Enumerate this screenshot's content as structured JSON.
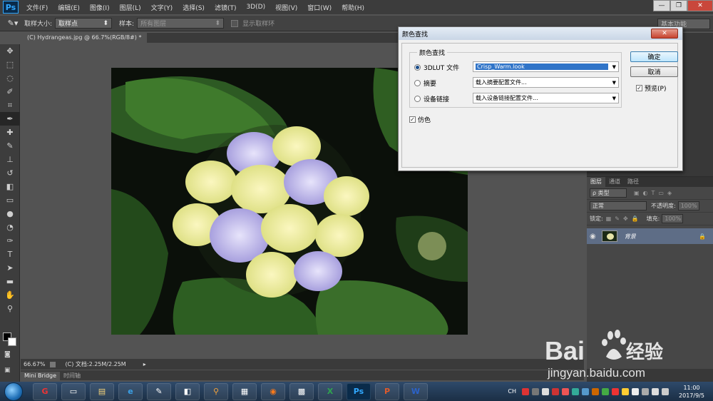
{
  "app": {
    "logo": "Ps",
    "menu": [
      "文件(F)",
      "编辑(E)",
      "图像(I)",
      "图层(L)",
      "文字(Y)",
      "选择(S)",
      "滤镜(T)",
      "3D(D)",
      "视图(V)",
      "窗口(W)",
      "帮助(H)"
    ],
    "window_controls": {
      "minimize": "—",
      "restore": "❐",
      "close": "✕"
    }
  },
  "options": {
    "sample_size_label": "取样大小:",
    "sample_size_value": "取样点",
    "sample_label": "样本:",
    "sample_value": "所有图层",
    "show_ring_label": "显示取样环",
    "workspace": "基本功能"
  },
  "document": {
    "tab_label": "(C) Hydrangeas.jpg @ 66.7%(RGB/8#) *",
    "tab_close": "×"
  },
  "status": {
    "zoom": "66.67%",
    "doc_info": "(C) 文档:2.25M/2.25M"
  },
  "bottom_tabs": [
    "Mini Bridge",
    "时间轴"
  ],
  "layers_panel": {
    "tabs": [
      "图层",
      "通道",
      "路径"
    ],
    "filter_label": "ρ 类型",
    "blend_mode": "正常",
    "opacity_label": "不透明度:",
    "opacity_value": "100%",
    "lock_label": "锁定:",
    "fill_label": "填充:",
    "fill_value": "100%",
    "layer_name": "背景"
  },
  "dialog": {
    "title": "颜色查找",
    "close": "✕",
    "group_title": "颜色查找",
    "rows": [
      {
        "label": "3DLUT 文件",
        "value": "Crisp_Warm.look",
        "selected": true
      },
      {
        "label": "摘要",
        "value": "载入摘要配置文件...",
        "selected": false
      },
      {
        "label": "设备链接",
        "value": "载入设备链接配置文件...",
        "selected": false
      }
    ],
    "dither_label": "仿色",
    "ok_label": "确定",
    "cancel_label": "取消",
    "preview_label": "预览(P)"
  },
  "taskbar": {
    "clock_time": "11:00",
    "clock_date": "2017/9/5",
    "lang": "CH"
  },
  "watermark": {
    "brand": "Bai",
    "brand2": "经验",
    "url": "jingyan.baidu.com"
  },
  "colors": {
    "accent": "#31a8ff",
    "dialog_selection": "#3074c8",
    "layer_selected": "#5e6d86"
  }
}
